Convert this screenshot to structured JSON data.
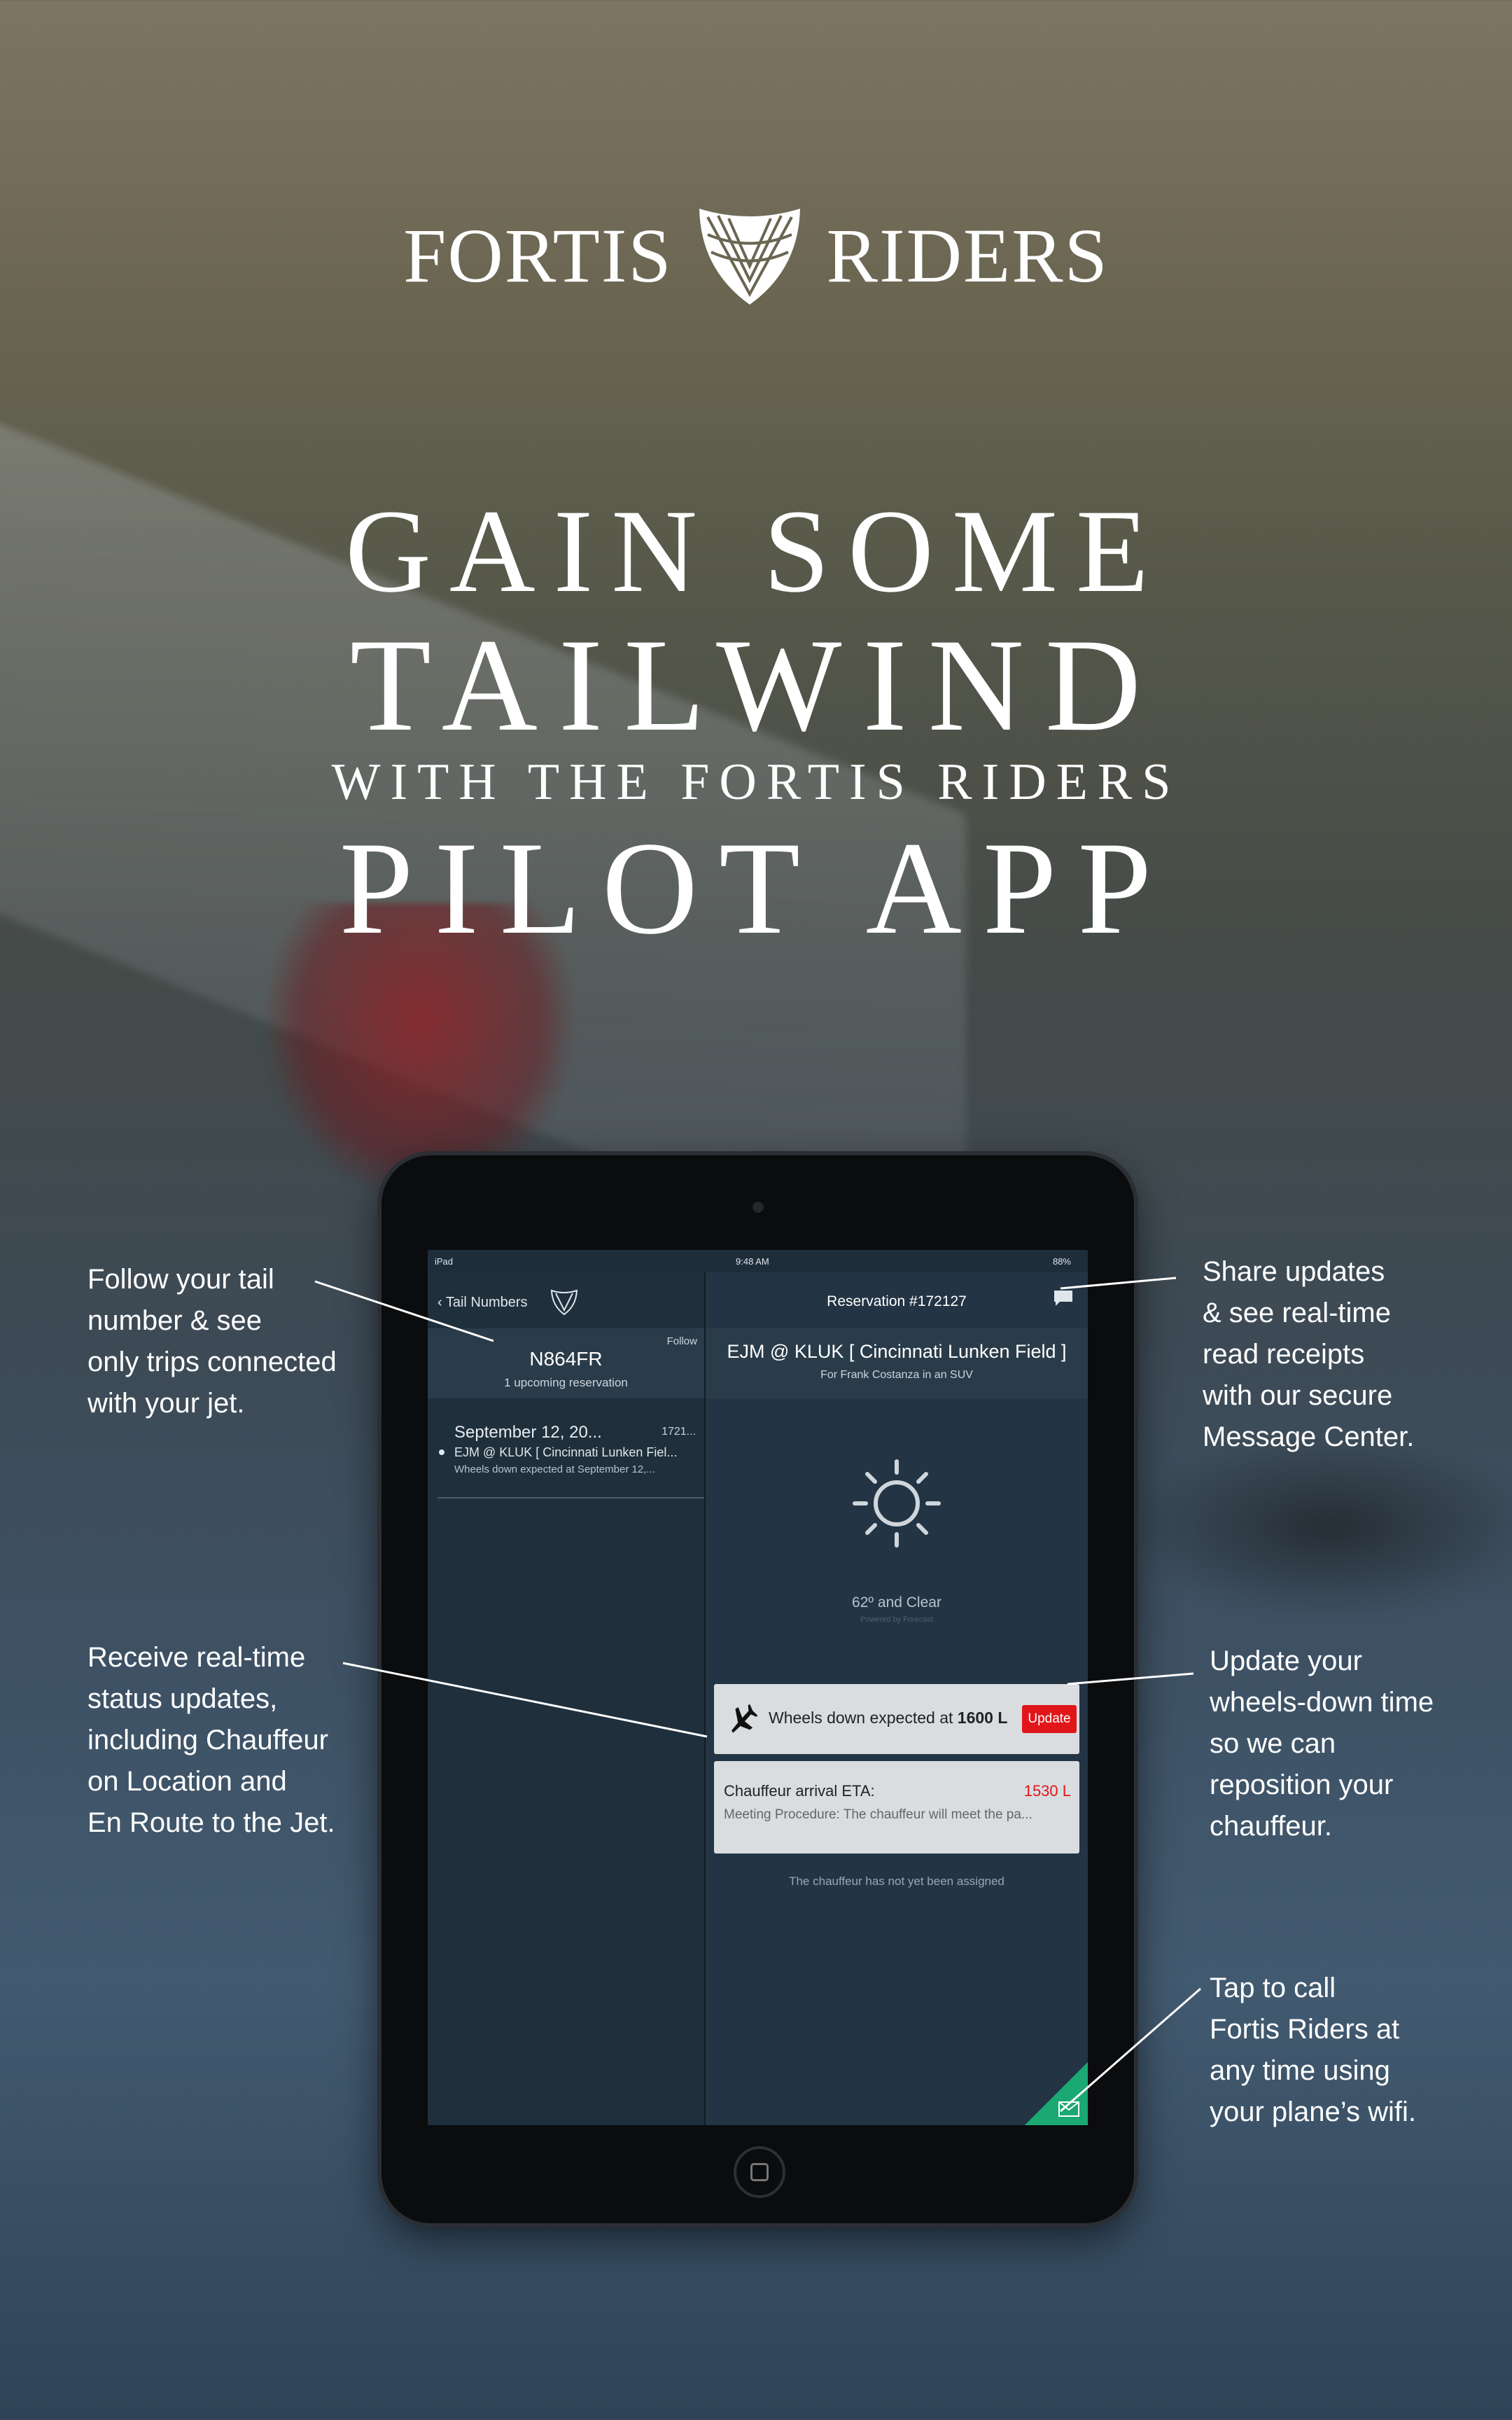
{
  "brand": {
    "left": "FORTIS",
    "right": "RIDERS"
  },
  "headline": {
    "line1": "GAIN SOME",
    "line2": "TAILWIND",
    "line3": "WITH THE FORTIS RIDERS",
    "line4": "PILOT APP"
  },
  "device": {
    "status_left": "iPad",
    "status_time": "9:48 AM",
    "status_battery": "88%",
    "left_pane": {
      "back_label": "Tail Numbers",
      "follow_label": "Follow",
      "tail_number": "N864FR",
      "upcoming": "1 upcoming reservation",
      "trip": {
        "date": "September 12, 20...",
        "code": "1721...",
        "route": "EJM @ KLUK [ Cincinnati Lunken Fiel...",
        "wheels": "Wheels down expected at September 12,..."
      }
    },
    "right_pane": {
      "title": "Reservation #172127",
      "destination": "EJM @ KLUK [ Cincinnati Lunken Field ]",
      "for_line": "For Frank Costanza in an SUV",
      "weather": "62º and Clear",
      "powered_by": "Powered by Forecast",
      "wheels_text": "Wheels down expected at",
      "wheels_time": "1600 L",
      "update_label": "Update",
      "eta_label": "Chauffeur arrival ETA:",
      "eta_time": "1530 L",
      "meeting": "Meeting Procedure: The chauffeur will meet the pa...",
      "assigned": "The chauffeur has not yet been assigned"
    }
  },
  "annotations": {
    "tail": [
      "Follow your tail",
      "number & see",
      "only trips connected",
      "with your jet."
    ],
    "status": [
      "Receive real-time",
      "status updates,",
      "including Chauffeur",
      "on Location and",
      "En Route to the Jet."
    ],
    "share": [
      "Share updates",
      "& see real-time",
      "read receipts",
      "with our secure",
      "Message Center."
    ],
    "update": [
      "Update your",
      "wheels-down time",
      "so we can",
      "reposition your",
      "chauffeur."
    ],
    "call": [
      "Tap to call",
      "Fortis Riders at",
      "any time using",
      "your plane’s wifi."
    ]
  },
  "colors": {
    "accent_red": "#e0161b",
    "call_green": "#1aa873",
    "screen_bg": "#1e2d3a"
  }
}
